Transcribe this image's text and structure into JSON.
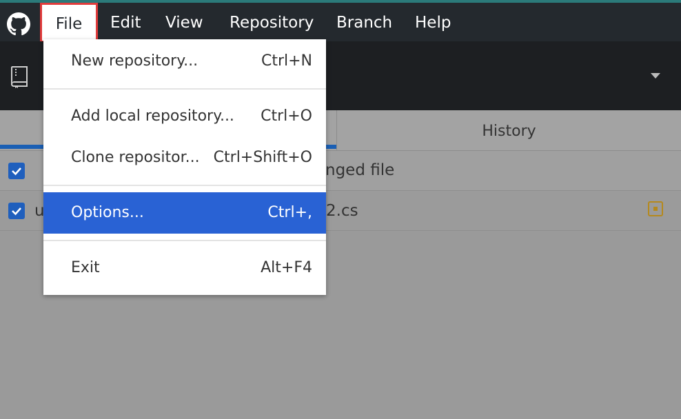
{
  "menubar": {
    "items": [
      "File",
      "Edit",
      "View",
      "Repository",
      "Branch",
      "Help"
    ]
  },
  "file_menu": {
    "items": [
      {
        "label": "New repository...",
        "shortcut": "Ctrl+N"
      },
      {
        "label": "Add local repository...",
        "shortcut": "Ctrl+O"
      },
      {
        "label": "Clone repositor...",
        "shortcut": "Ctrl+Shift+O"
      },
      {
        "label": "Options...",
        "shortcut": "Ctrl+,"
      },
      {
        "label": "Exit",
        "shortcut": "Alt+F4"
      }
    ]
  },
  "tabs": {
    "history": "History"
  },
  "changes": {
    "summary": "nged file",
    "file_prefix": "u",
    "file_suffix": "2.cs"
  },
  "colors": {
    "menubar": "#24292e",
    "highlight": "#2962d4",
    "checkbox": "#1f5fbd",
    "modified": "#b5891c",
    "file_outline": "#e03b3b"
  }
}
